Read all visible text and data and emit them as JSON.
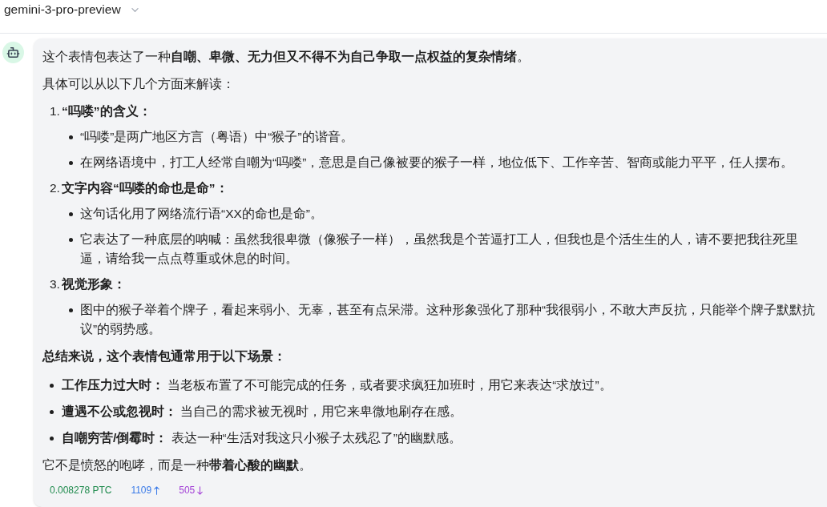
{
  "header": {
    "model": "gemini-3-pro-preview"
  },
  "message": {
    "blocks": [
      {
        "kind": "paragraph",
        "text": "这个表情包表达了一种**自嘲、卑微、无力但又不得不为自己争取一点权益的复杂情绪**。"
      },
      {
        "kind": "paragraph",
        "text": "具体可以从以下几个方面来解读："
      },
      {
        "kind": "numbered_list",
        "items": [
          {
            "marker": "1.",
            "title": "“吗喽”的含义：",
            "bullets": [
              "“吗喽”是两广地区方言（粤语）中“猴子”的谐音。",
              "在网络语境中，打工人经常自嘲为“吗喽”，意思是自己像被要的猴子一样，地位低下、工作辛苦、智商或能力平平，任人摆布。"
            ]
          },
          {
            "marker": "2.",
            "title": "文字内容“吗喽的命也是命”：",
            "bullets": [
              "这句话化用了网络流行语“XX的命也是命”。",
              "它表达了一种底层的呐喊：虽然我很卑微（像猴子一样），虽然我是个苦逼打工人，但我也是个活生生的人，请不要把我往死里逼，请给我一点点尊重或休息的时间。"
            ]
          },
          {
            "marker": "3.",
            "title": "视觉形象：",
            "bullets": [
              "图中的猴子举着个牌子，看起来弱小、无辜，甚至有点呆滞。这种形象强化了那种“我很弱小，不敢大声反抗，只能举个牌子默默抗议”的弱势感。"
            ]
          }
        ]
      },
      {
        "kind": "heading",
        "text": "总结来说，这个表情包通常用于以下场景："
      },
      {
        "kind": "bullet_list",
        "items": [
          "**工作压力过大时：** 当老板布置了不可能完成的任务，或者要求疯狂加班时，用它来表达“求放过”。",
          "**遭遇不公或忽视时：** 当自己的需求被无视时，用它来卑微地刷存在感。",
          "**自嘲穷苦/倒霉时：** 表达一种“生活对我这只小猴子太残忍了”的幽默感。"
        ]
      },
      {
        "kind": "paragraph",
        "text": "它不是愤怒的咆哮，而是一种**带着心酸的幽默**。"
      }
    ],
    "stats": {
      "cost": "0.008278 PTC",
      "tokens_up": "1109",
      "tokens_down": "505"
    }
  }
}
